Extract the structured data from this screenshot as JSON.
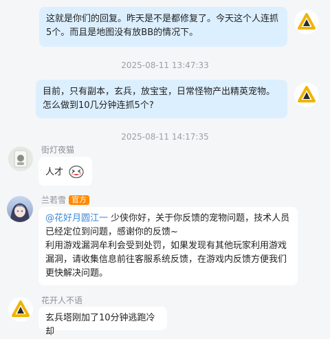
{
  "messages": [
    {
      "type": "self",
      "text": "这就是你们的回复。昨天是不是都修复了。今天这个人连抓5个。而且是地图没有放BB的情况下。"
    },
    {
      "type": "time",
      "text": "2025-08-11 13:47:33"
    },
    {
      "type": "self",
      "text": "目前，只有副本，玄兵，放宝宝，日常怪物产出精英宠物。怎么做到10几分钟连抓5个?"
    },
    {
      "type": "time",
      "text": "2025-08-11 14:17:35"
    },
    {
      "type": "other",
      "name": "街灯夜猫",
      "text": "人才"
    },
    {
      "type": "other",
      "name": "兰若雪",
      "badge": "官方",
      "mention": "@花好月圆江一",
      "text": " 少侠你好，关于你反馈的宠物问题，技术人员已经定位到问题，感谢你的反馈~\n利用游戏漏洞牟利会受到处罚，如果发现有其他玩家利用游戏漏洞，请收集信息前往客服系统反馈，在游戏内反馈方便我们更快解决问题。"
    },
    {
      "type": "other",
      "name": "花开人不语",
      "text": "玄兵塔刚加了10分钟逃跑冷却"
    }
  ],
  "colors": {
    "self_bubble": "#dcefff",
    "other_bubble": "#ffffff",
    "official_badge": "#ff8a00",
    "mention": "#3a86d8"
  },
  "icons": {
    "self_avatar": "gold-triangle-logo",
    "emoji": "laughing-face-emoji"
  }
}
